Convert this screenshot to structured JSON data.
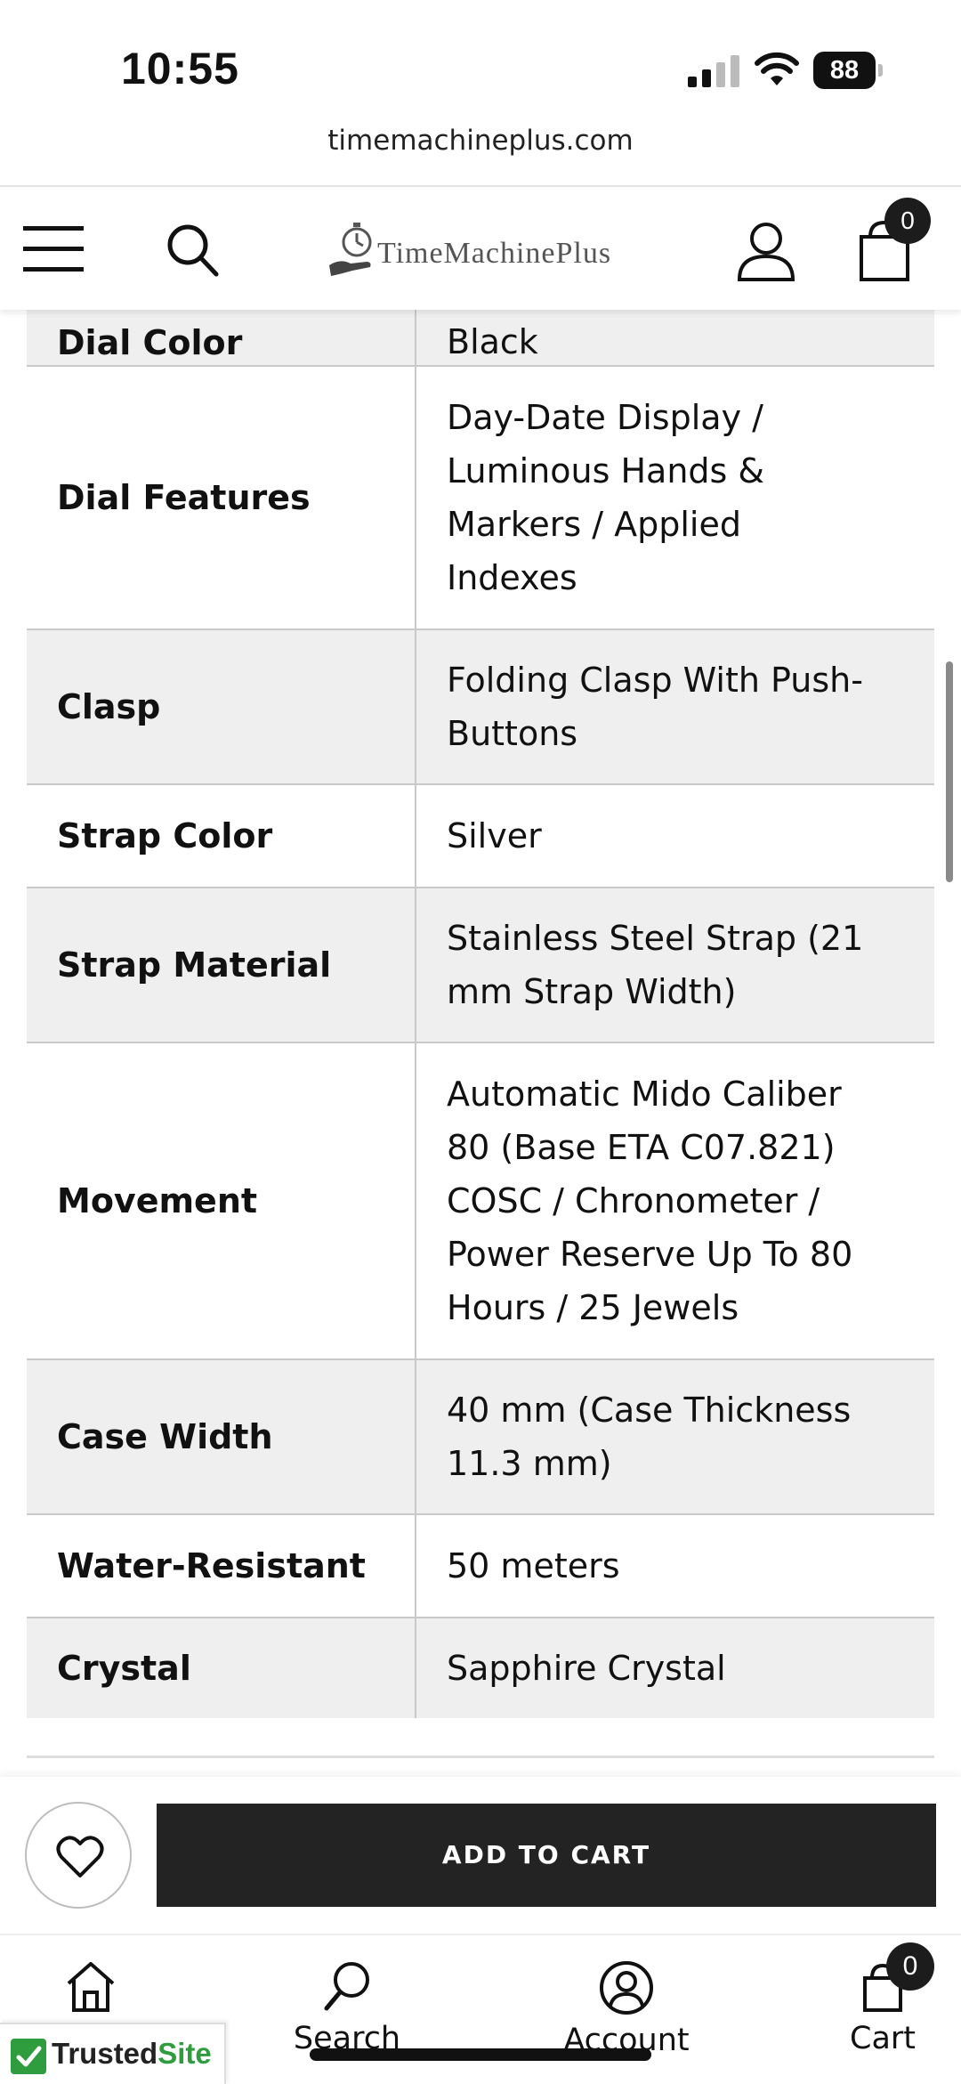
{
  "status_bar": {
    "time": "10:55",
    "battery": "88"
  },
  "browser": {
    "url": "timemachineplus.com"
  },
  "header": {
    "logo_text": "TimeMachinePlus",
    "cart_count": "0"
  },
  "specs": [
    {
      "label": "Dial Color",
      "value": [
        "Black"
      ]
    },
    {
      "label": "Dial Features",
      "value": [
        "Day-Date Display /",
        "Luminous Hands &",
        "Markers / Applied",
        "Indexes"
      ]
    },
    {
      "label": "Clasp",
      "value": [
        "Folding Clasp With Push-",
        "Buttons"
      ]
    },
    {
      "label": "Strap Color",
      "value": [
        "Silver"
      ]
    },
    {
      "label": "Strap Material",
      "value": [
        "Stainless Steel Strap (21",
        "mm Strap Width)"
      ]
    },
    {
      "label": "Movement",
      "value": [
        "Automatic Mido Caliber",
        "80 (Base ETA C07.821)",
        "COSC / Chronometer /",
        "Power Reserve Up To 80",
        "Hours / 25 Jewels"
      ]
    },
    {
      "label": "Case Width",
      "value": [
        "40 mm (Case Thickness",
        "11.3 mm)"
      ]
    },
    {
      "label": "Water-Resistant",
      "value": [
        "50 meters"
      ]
    },
    {
      "label": "Crystal",
      "value": [
        "Sapphire Crystal"
      ]
    }
  ],
  "sticky": {
    "add_to_cart_label": "ADD TO CART"
  },
  "bottom_nav": {
    "home_label": "",
    "search_label": "Search",
    "account_label": "Account",
    "cart_label": "Cart",
    "cart_count": "0"
  },
  "trusted_site": {
    "brand_part1": "Trusted",
    "brand_part2": "Site"
  },
  "colors": {
    "accent_dark": "#232323",
    "row_alt": "#efefef",
    "trusted_green": "#2f9c3e"
  }
}
